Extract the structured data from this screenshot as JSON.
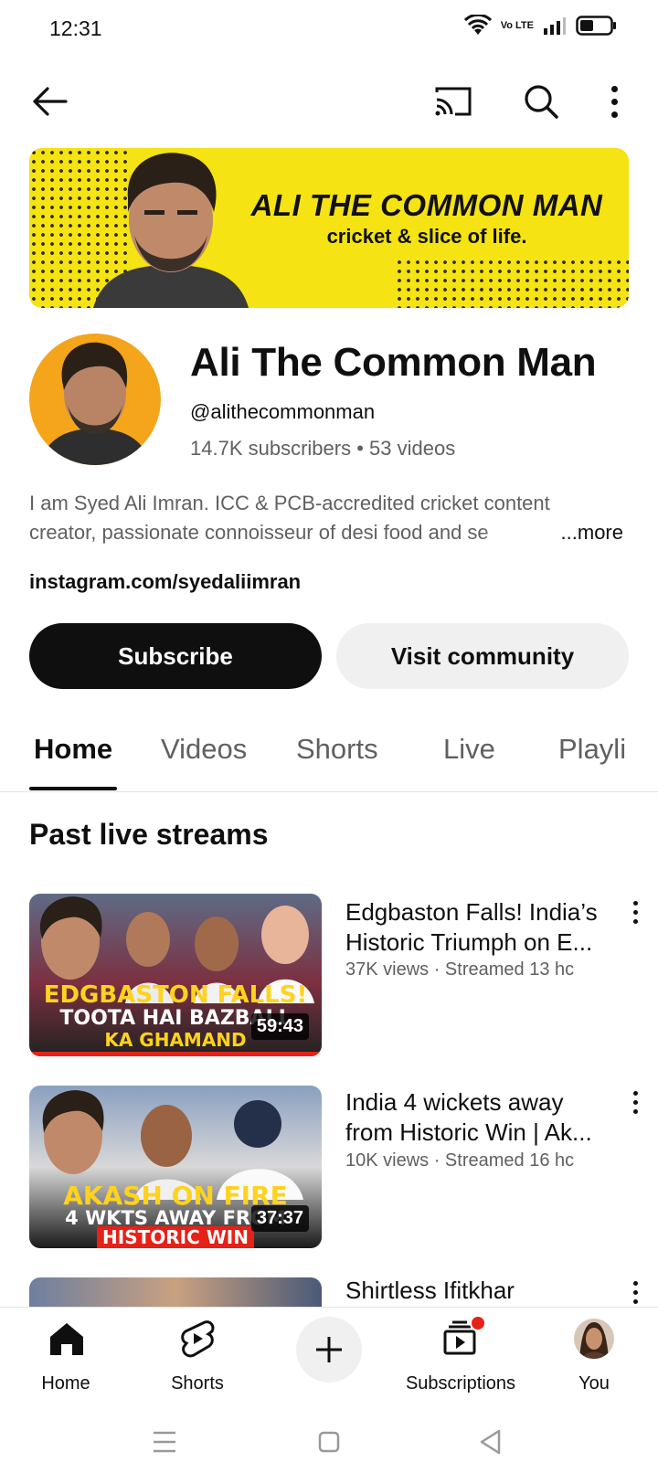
{
  "status_bar": {
    "time": "12:31",
    "volte": "Vo LTE"
  },
  "banner": {
    "title": "ALI THE COMMON MAN",
    "subtitle": "cricket & slice of life."
  },
  "channel": {
    "name": "Ali The Common Man",
    "handle": "@alithecommonman",
    "stats": "14.7K subscribers • 53 videos",
    "description_line1": "I am Syed Ali Imran. ICC & PCB-accredited cricket content",
    "description_line2": "creator, passionate connoisseur of desi food and se",
    "more_label": "...more",
    "link": "instagram.com/syedaliimran"
  },
  "actions": {
    "subscribe": "Subscribe",
    "community": "Visit community"
  },
  "tabs": [
    "Home",
    "Videos",
    "Shorts",
    "Live",
    "Playli"
  ],
  "section": {
    "title": "Past live streams"
  },
  "videos": [
    {
      "title_line1": "Edgbaston Falls! India’s",
      "title_line2": "Historic Triumph on E...",
      "meta": "37K views · Streamed 13 hc",
      "duration": "59:43",
      "thumb_line1": "EDGBASTON FALLS!",
      "thumb_line2": "TOOTA HAI BAZBALL",
      "thumb_line3": "KA GHAMAND"
    },
    {
      "title_line1": "India 4 wickets away",
      "title_line2": "from Historic Win | Ak...",
      "meta": "10K views · Streamed 16 hc",
      "duration": "37:37",
      "thumb_line1": "AKASH ON FIRE",
      "thumb_line2": "4 WKTS AWAY FROM",
      "thumb_line3": "HISTORIC WIN"
    },
    {
      "title_line1": "Shirtless Ifitkhar"
    }
  ],
  "bottom_nav": {
    "home": "Home",
    "shorts": "Shorts",
    "subscriptions": "Subscriptions",
    "you": "You"
  },
  "colors": {
    "brand_yellow": "#f5e313",
    "avatar_bg": "#f4a51c",
    "notification_red": "#e62117",
    "text_secondary": "#606060"
  }
}
